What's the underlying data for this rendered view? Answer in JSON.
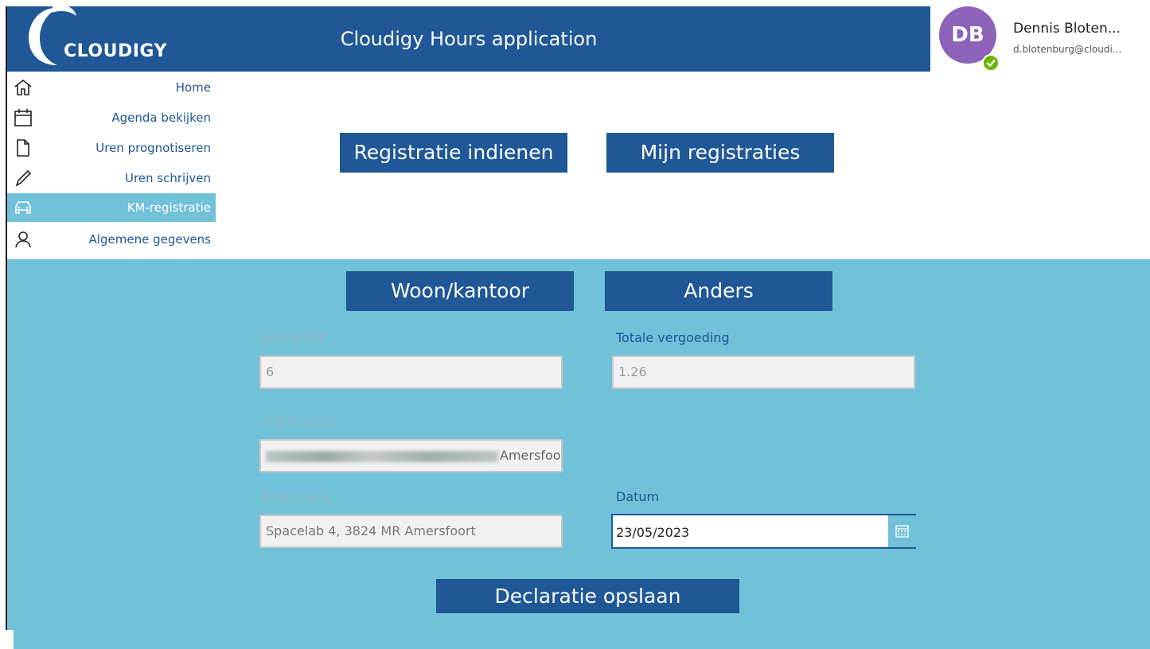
{
  "header": {
    "logo_text": "CLOUDIGY",
    "app_title": "Cloudigy Hours application"
  },
  "profile": {
    "initials": "DB",
    "name": "Dennis Bloten...",
    "email": "d.blotenburg@cloudi..."
  },
  "sidebar": {
    "items": [
      {
        "label": "Home",
        "icon": "home-icon",
        "active": false
      },
      {
        "label": "Agenda bekijken",
        "icon": "calendar-icon",
        "active": false
      },
      {
        "label": "Uren prognotiseren",
        "icon": "document-icon",
        "active": false
      },
      {
        "label": "Uren schrijven",
        "icon": "pencil-icon",
        "active": false
      },
      {
        "label": "KM-registratie",
        "icon": "car-icon",
        "active": true
      },
      {
        "label": "Algemene gegevens",
        "icon": "person-icon",
        "active": false
      }
    ]
  },
  "top_buttons": {
    "registratie_indienen": "Registratie indienen",
    "mijn_registraties": "Mijn registraties"
  },
  "type_buttons": {
    "woon_kantoor": "Woon/kantoor",
    "anders": "Anders"
  },
  "form": {
    "aantal_km_label": "Aantal KM",
    "aantal_km_value": "6",
    "totale_vergoeding_label": "Totale vergoeding",
    "totale_vergoeding_value": "1.26",
    "startlocatie_label": "Startlocatie",
    "startlocatie_value_visible": "Amersfoo",
    "eindlocatie_label": "Eindlocatie",
    "eindlocatie_value": "Spacelab 4, 3824 MR Amersfoort",
    "datum_label": "Datum",
    "datum_value": "23/05/2023"
  },
  "save_button": "Declaratie opslaan",
  "colors": {
    "brand_blue": "#1f5797",
    "panel_teal": "#71c1d9",
    "avatar_purple": "#8c63b8",
    "presence_green": "#6bb700"
  }
}
